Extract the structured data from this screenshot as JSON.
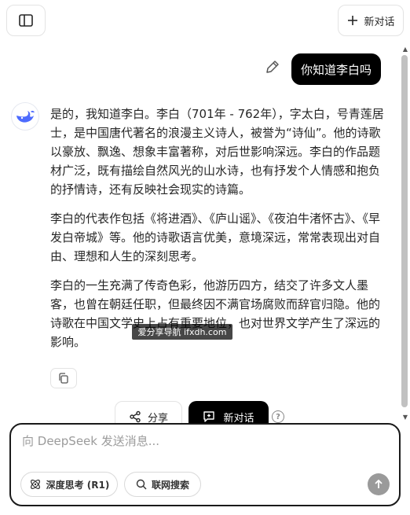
{
  "header": {
    "new_chat_label": "新对话"
  },
  "user_message": {
    "text": "你知道李白吗"
  },
  "answer": {
    "paragraphs": [
      "是的，我知道李白。李白（701年 - 762年），字太白，号青莲居士，是中国唐代著名的浪漫主义诗人，被誉为“诗仙”。他的诗歌以豪放、飘逸、想象丰富著称，对后世影响深远。李白的作品题材广泛，既有描绘自然风光的山水诗，也有抒发个人情感和抱负的抒情诗，还有反映社会现实的诗篇。",
      "李白的代表作包括《将进酒》、《庐山谣》、《夜泊牛渚怀古》、《早发白帝城》等。他的诗歌语言优美，意境深远，常常表现出对自由、理想和人生的深刻思考。",
      "李白的一生充满了传奇色彩，他游历四方，结交了许多文人墨客，也曾在朝廷任职，但最终因不满官场腐败而辞官归隐。他的诗歌在中国文学史上占有重要地位，也对世界文学产生了深远的影响。"
    ]
  },
  "watermark": {
    "text": "爱分享导航 ifxdh.com"
  },
  "actions": {
    "share_label": "分享",
    "new_chat_label": "新对话"
  },
  "composer": {
    "placeholder": "向 DeepSeek 发送消息...",
    "deep_think_label": "深度思考 (R1)",
    "web_search_label": "联网搜索"
  },
  "colors": {
    "brand_blue": "#4d6bfe",
    "dark_button": "#000000",
    "send_disabled": "#9a9a9a"
  }
}
